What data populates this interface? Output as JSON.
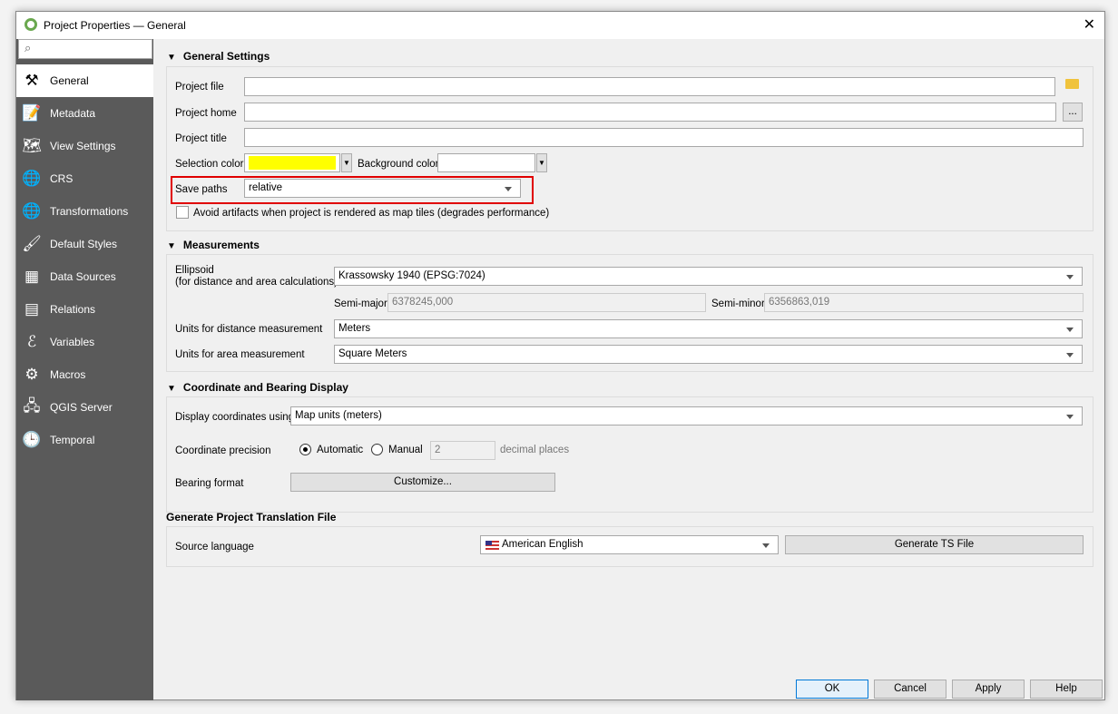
{
  "window": {
    "title": "Project Properties — General",
    "close": "✕"
  },
  "sidebar": {
    "items": [
      {
        "label": "General",
        "icon": "tools-icon"
      },
      {
        "label": "Metadata",
        "icon": "metadata-icon"
      },
      {
        "label": "View Settings",
        "icon": "view-settings-icon"
      },
      {
        "label": "CRS",
        "icon": "globe-icon"
      },
      {
        "label": "Transformations",
        "icon": "transform-icon"
      },
      {
        "label": "Default Styles",
        "icon": "brush-icon"
      },
      {
        "label": "Data Sources",
        "icon": "table-icon"
      },
      {
        "label": "Relations",
        "icon": "relations-icon"
      },
      {
        "label": "Variables",
        "icon": "variables-icon"
      },
      {
        "label": "Macros",
        "icon": "macros-icon"
      },
      {
        "label": "QGIS Server",
        "icon": "server-icon"
      },
      {
        "label": "Temporal",
        "icon": "clock-icon"
      }
    ]
  },
  "general": {
    "title": "General Settings",
    "project_file": "Project file",
    "project_home": "Project home",
    "project_title": "Project title",
    "selection_color": "Selection color",
    "selection_color_value": "#ffff00",
    "background_color": "Background color",
    "background_color_value": "#ffffff",
    "save_paths": "Save paths",
    "save_paths_value": "relative",
    "avoid_artifacts": "Avoid artifacts when project is rendered as map tiles (degrades performance)",
    "browse": "..."
  },
  "measurements": {
    "title": "Measurements",
    "ellipsoid": "Ellipsoid",
    "ellipsoid_sub": "(for distance and area calculations)",
    "ellipsoid_value": "Krassowsky 1940 (EPSG:7024)",
    "semi_major": "Semi-major",
    "semi_major_value": "6378245,000",
    "semi_minor": "Semi-minor",
    "semi_minor_value": "6356863,019",
    "distance_units": "Units for distance measurement",
    "distance_units_value": "Meters",
    "area_units": "Units for area measurement",
    "area_units_value": "Square Meters"
  },
  "coords": {
    "title": "Coordinate and Bearing Display",
    "display_using": "Display coordinates using",
    "display_using_value": "Map units (meters)",
    "precision": "Coordinate precision",
    "automatic": "Automatic",
    "manual": "Manual",
    "manual_value": "2",
    "decimal_places": "decimal places",
    "bearing": "Bearing format",
    "customize": "Customize..."
  },
  "translation": {
    "title": "Generate Project Translation File",
    "source_language": "Source language",
    "language_value": "American English",
    "generate": "Generate TS File"
  },
  "buttons": {
    "ok": "OK",
    "cancel": "Cancel",
    "apply": "Apply",
    "help": "Help"
  },
  "colors": {
    "highlight": "#e00000",
    "sidebar": "#5a5a5a"
  }
}
